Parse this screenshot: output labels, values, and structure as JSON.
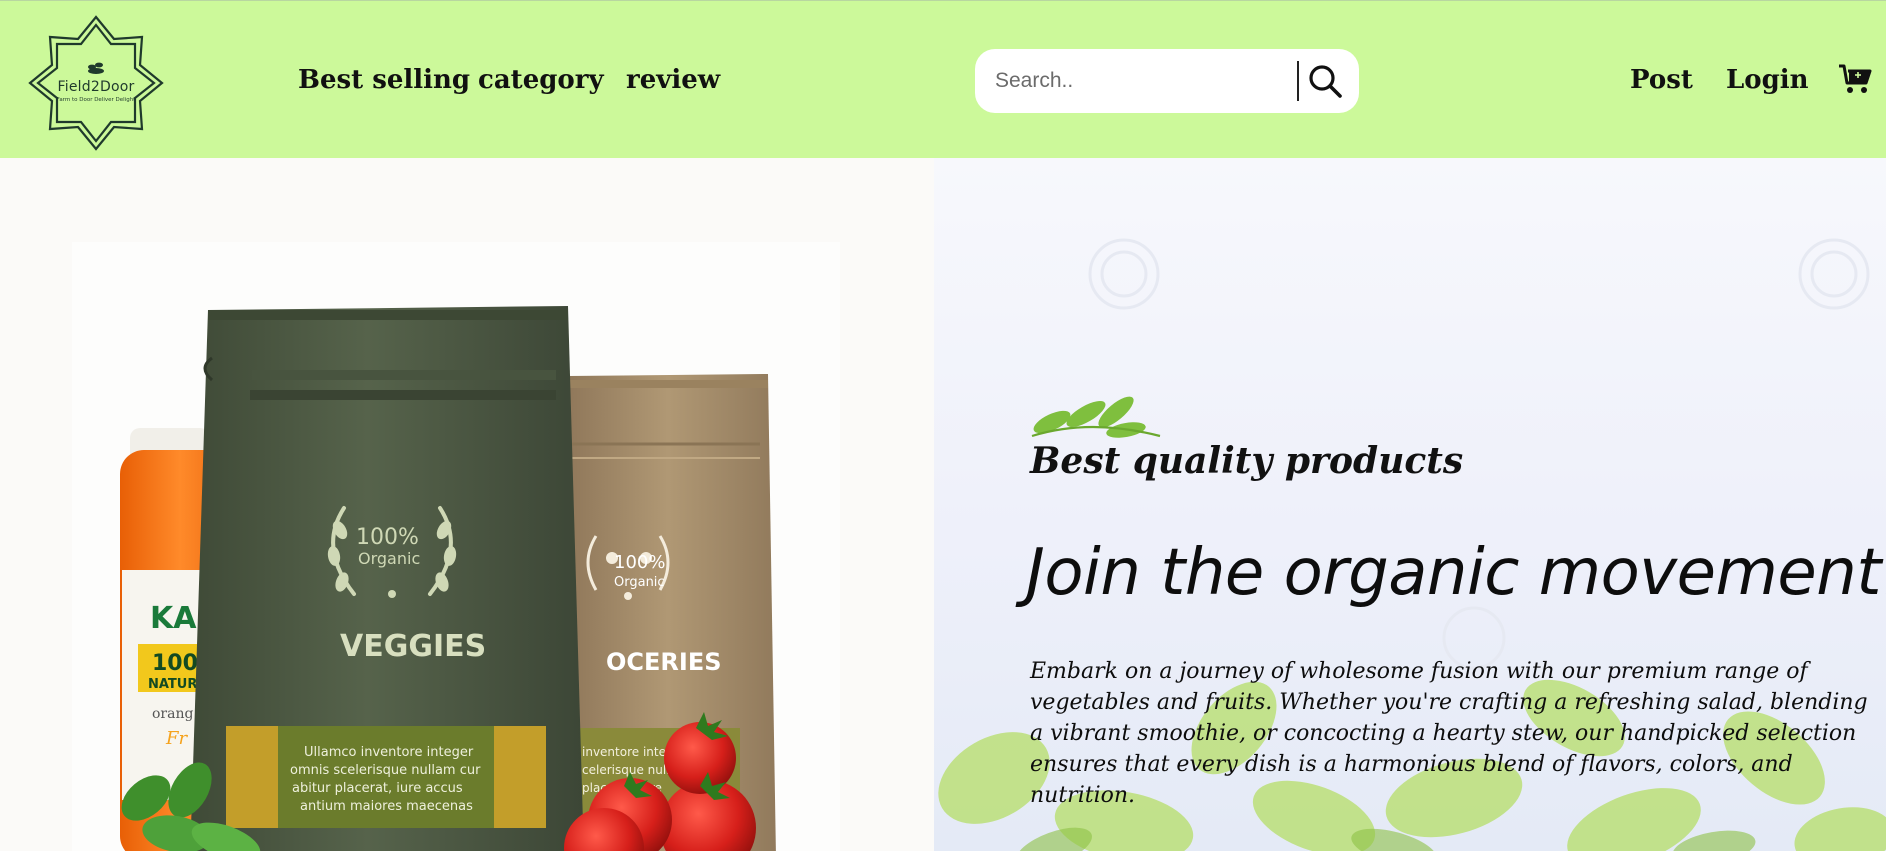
{
  "logo": {
    "name": "Field2Door",
    "tagline": "Farm to Door Deliver Delight"
  },
  "nav": {
    "best_selling": "Best selling",
    "category": "category",
    "review": "review",
    "post": "Post",
    "login": "Login"
  },
  "search": {
    "placeholder": "Search..",
    "value": ""
  },
  "icons": {
    "search": "search-icon",
    "cart": "cart-icon"
  },
  "hero": {
    "subtitle": "Best quality products",
    "title": "Join the organic movement!",
    "description": "Embark on a journey of wholesome fusion with our premium range of vegetables and fruits. Whether you're crafting a refreshing salad, blending a vibrant smoothie, or concocting a hearty stew, our handpicked selection ensures that every dish is a harmonious blend of flavors, colors, and nutrition."
  },
  "product_image": {
    "bag_front_badge_pct": "100%",
    "bag_front_badge_word": "Organic",
    "bag_front_label": "VEGGIES",
    "bag_front_caption_lines": [
      "Ullamco inventore integer",
      "omnis scelerisque nullam cur",
      "abitur placerat, iure accus",
      "antium maiores maecenas"
    ],
    "bag_back_badge_pct": "100%",
    "bag_back_badge_word": "Organic",
    "bag_back_label": "OCERIES",
    "bag_back_caption_lines": [
      "inventore integer",
      "celerisque nulla",
      "placerat, iure"
    ],
    "jar_label_1": "KARI",
    "jar_label_2": "100",
    "jar_label_3": "NATUR",
    "jar_label_4": "orang",
    "jar_label_5": "Fr"
  },
  "colors": {
    "header_bg": "#ccf99a",
    "bag_front": "#4e5b45",
    "bag_back": "#a88f6c",
    "jar": "#f26f14"
  }
}
